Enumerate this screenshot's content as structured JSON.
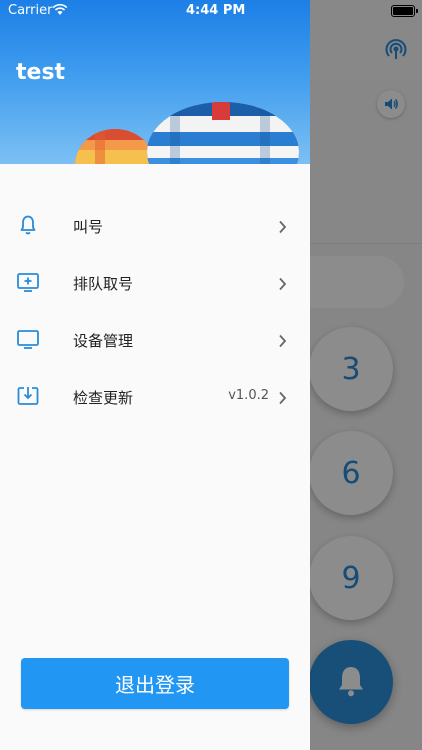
{
  "status_bar": {
    "carrier": "Carrier",
    "time": "4:44 PM"
  },
  "drawer": {
    "username": "test",
    "menu": [
      {
        "label": "叫号",
        "icon": "bell-icon",
        "value": ""
      },
      {
        "label": "排队取号",
        "icon": "add-screen-icon",
        "value": ""
      },
      {
        "label": "设备管理",
        "icon": "monitor-icon",
        "value": ""
      },
      {
        "label": "检查更新",
        "icon": "download-icon",
        "value": "v1.0.2"
      }
    ],
    "logout_label": "退出登录"
  },
  "background_app": {
    "keypad": [
      "3",
      "6",
      "9"
    ]
  },
  "colors": {
    "accent": "#2196f3",
    "icon_blue": "#2a8bd8"
  }
}
